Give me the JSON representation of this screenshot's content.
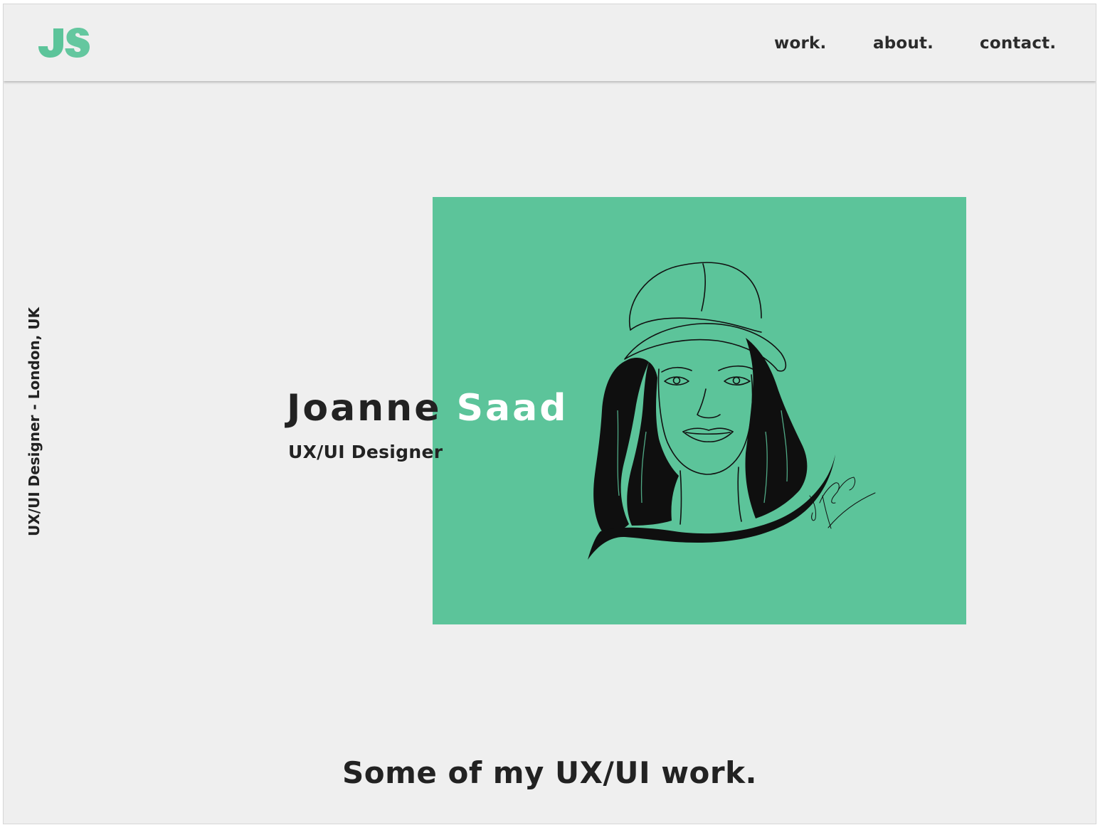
{
  "header": {
    "logo_text": "JS",
    "logo_color": "#5cc49a",
    "nav": [
      {
        "label": "work."
      },
      {
        "label": "about."
      },
      {
        "label": "contact."
      }
    ]
  },
  "sidebar": {
    "caption": "UX/UI Designer - London, UK"
  },
  "hero": {
    "first_name": "Joanne",
    "last_name": "Saad",
    "role": "UX/UI Designer",
    "card_color": "#5cc49a",
    "illustration": "line-art-portrait-woman-cap",
    "signature": "Joanne Saad"
  },
  "work_section": {
    "heading": "Some of my UX/UI work."
  },
  "colors": {
    "background": "#efefef",
    "text": "#222222",
    "accent": "#5cc49a"
  }
}
